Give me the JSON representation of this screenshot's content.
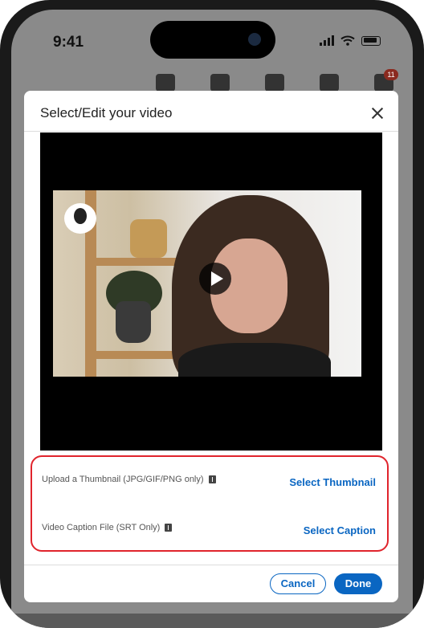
{
  "status_bar": {
    "time": "9:41"
  },
  "nav": {
    "notifications_badge": "11"
  },
  "modal": {
    "title": "Select/Edit your video",
    "close_icon": "close-icon",
    "play_icon": "play-icon",
    "options": {
      "thumbnail_label": "Upload a Thumbnail (JPG/GIF/PNG only)",
      "thumbnail_action": "Select Thumbnail",
      "caption_label": "Video Caption File (SRT Only)",
      "caption_action": "Select Caption"
    },
    "buttons": {
      "cancel": "Cancel",
      "done": "Done"
    }
  },
  "colors": {
    "accent": "#0a66c2",
    "highlight_border": "#e0242c"
  }
}
